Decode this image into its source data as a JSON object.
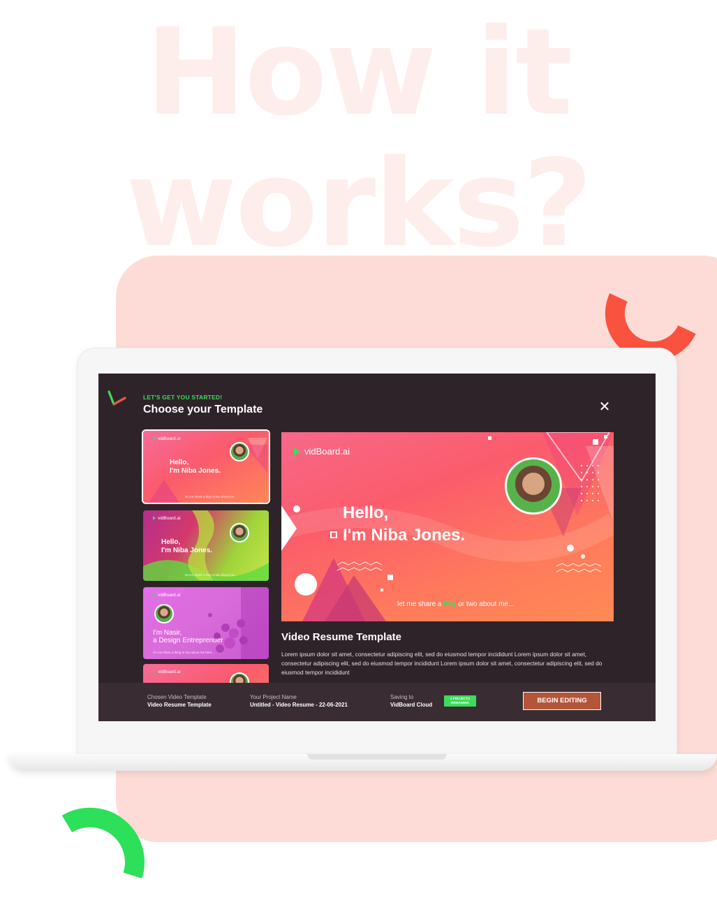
{
  "hero": {
    "title": "How it works?"
  },
  "colors": {
    "accent_green": "#3ddc5b",
    "accent_red": "#f9533f",
    "panel_pink": "#fddcd7",
    "modal_bg": "#2e2329",
    "button": "#b4553a"
  },
  "modal": {
    "eyebrow": "LET'S GET YOU STARTED!",
    "title": "Choose your Template",
    "close_icon": "close-icon"
  },
  "thumbnails": [
    {
      "logo": "vidBoard.ai",
      "heading_line1": "Hello,",
      "heading_line2": "I'm Niba Jones.",
      "tagline": "let me share a thig or two about me..."
    },
    {
      "logo": "vidBoard.ai",
      "heading_line1": "Hello,",
      "heading_line2": "I'm Niba Jones.",
      "tagline": "let me share a thig or two about me..."
    },
    {
      "logo": "vidBoard.ai",
      "heading_line1": "I'm Nasir,",
      "heading_line2": "a Design Entreprenuer",
      "tagline": "i'm me share a thing or two about me here..."
    },
    {
      "logo": "vidBoard.ai"
    }
  ],
  "preview": {
    "logo": "vidBoard.ai",
    "heading_line1": "Hello,",
    "heading_line2": "I'm Niba Jones.",
    "tagline_before": "let me share a ",
    "tagline_highlight": "thig",
    "tagline_after": " or two about me..."
  },
  "template": {
    "name": "Video Resume Template",
    "description": "Lorem ipsum dolor sit amet, consectetur adipiscing elit, sed do eiusmod tempor incididunt Lorem ipsum dolor sit amet, consectetur adipiscing elit, sed do eiusmod tempor incididunt Lorem ipsum dolor sit amet, consectetur adipiscing elit, sed do eiusmod tempor incididunt"
  },
  "footer": {
    "chosen_label": "Chosen Video Template",
    "chosen_value": "Video Resume Template",
    "project_label": "Your Project Name",
    "project_value": "Untitled - Video Resume - 22-06-2021",
    "saving_label": "Saving to",
    "saving_value": "VidBoard Cloud",
    "badge_line1": "2 PROJECTS",
    "badge_line2": "REMAINING",
    "begin_button": "BEGIN EDITING"
  }
}
